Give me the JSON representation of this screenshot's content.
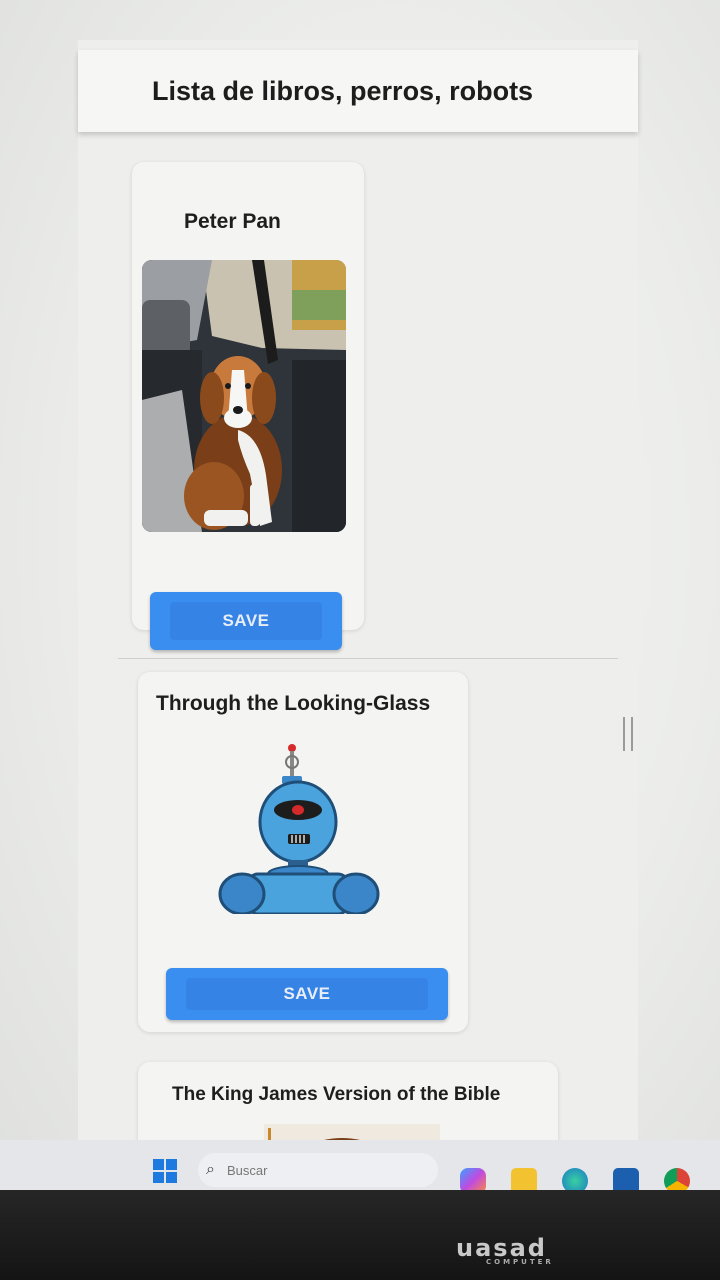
{
  "app": {
    "title": "Lista de libros, perros, robots"
  },
  "cards": [
    {
      "title": "Peter Pan",
      "image": "beagle-dog-photo",
      "button_label": "SAVE"
    },
    {
      "title": "Through the Looking-Glass",
      "image": "blue-robot-illustration",
      "button_label": "SAVE"
    },
    {
      "title": "The King James Version of the Bible",
      "image": "partial-photo"
    }
  ],
  "taskbar": {
    "search_placeholder": "Buscar",
    "icons": [
      "windows-start-icon",
      "search-icon",
      "copilot-icon",
      "file-explorer-icon",
      "edge-browser-icon",
      "store-icon",
      "chrome-icon"
    ]
  },
  "monitor": {
    "brand": "uasad",
    "brand_sub": "COMPUTER"
  },
  "colors": {
    "button_blue": "#3a8ef0",
    "card_bg": "#f4f4f2",
    "bezel": "#1a1a1a"
  }
}
